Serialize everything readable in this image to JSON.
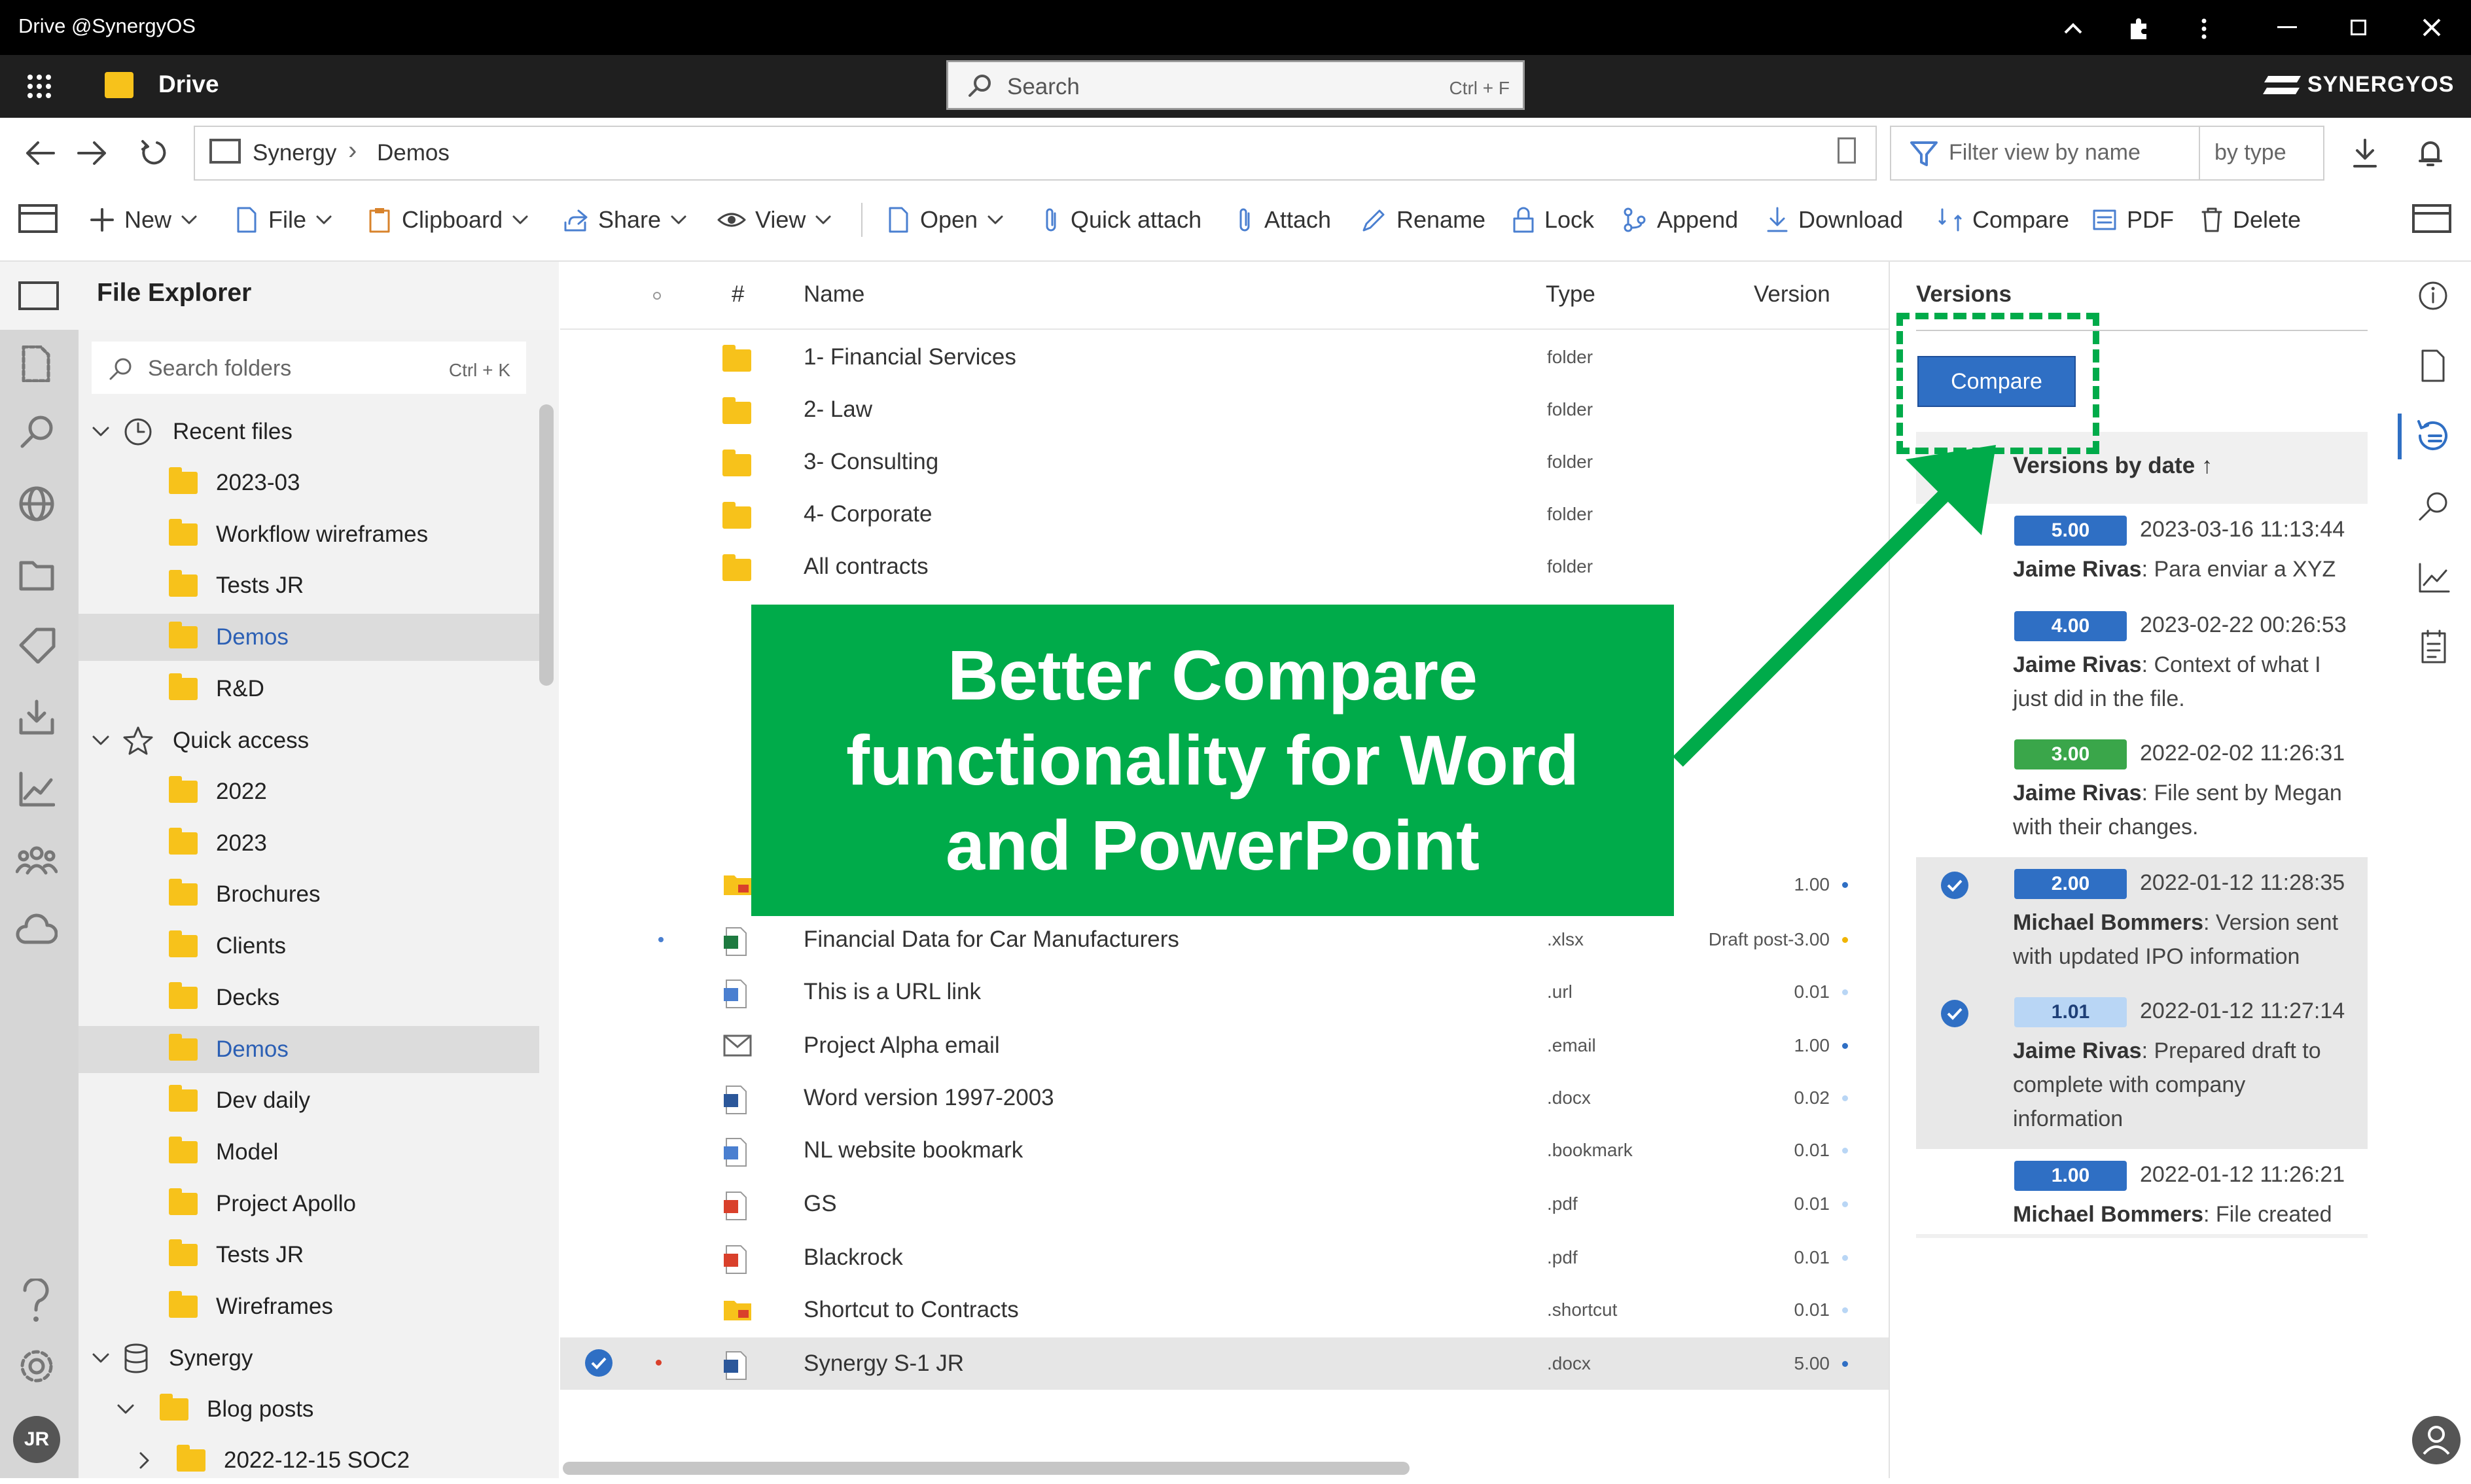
{
  "window": {
    "title": "Drive @SynergyOS"
  },
  "header": {
    "app_name": "Drive",
    "brand": "SYNERGYOS",
    "search_placeholder": "Search",
    "search_shortcut": "Ctrl + F"
  },
  "address": {
    "crumbs": [
      "Synergy",
      "Demos"
    ],
    "filter_placeholder": "Filter view by name",
    "by_type": "by type"
  },
  "toolbar": {
    "new": "New",
    "file": "File",
    "clipboard": "Clipboard",
    "share": "Share",
    "view": "View",
    "open": "Open",
    "quick_attach": "Quick attach",
    "attach": "Attach",
    "rename": "Rename",
    "lock": "Lock",
    "append": "Append",
    "download": "Download",
    "compare": "Compare",
    "pdf": "PDF",
    "delete": "Delete"
  },
  "explorer": {
    "title": "File Explorer",
    "search_placeholder": "Search folders",
    "search_shortcut": "Ctrl + K",
    "recent_label": "Recent files",
    "recent": [
      "2023-03",
      "Workflow wireframes",
      "Tests JR",
      "Demos",
      "R&D"
    ],
    "quick_label": "Quick access",
    "quick": [
      "2022",
      "2023",
      "Brochures",
      "Clients",
      "Decks",
      "Demos",
      "Dev daily",
      "Model",
      "Project Apollo",
      "Tests JR",
      "Wireframes"
    ],
    "synergy_label": "Synergy",
    "synergy_child": "Blog posts",
    "synergy_grandchild": "2022-12-15 SOC2",
    "avatar": "JR"
  },
  "list": {
    "headers": {
      "hash": "#",
      "name": "Name",
      "type": "Type",
      "version": "Version"
    },
    "rows": [
      {
        "name": "1- Financial Services",
        "type": "folder",
        "version": ""
      },
      {
        "name": "2- Law",
        "type": "folder",
        "version": ""
      },
      {
        "name": "3- Consulting",
        "type": "folder",
        "version": ""
      },
      {
        "name": "4- Corporate",
        "type": "folder",
        "version": ""
      },
      {
        "name": "All contracts",
        "type": "folder",
        "version": ""
      },
      {
        "name": "",
        "type": "",
        "version": "1.00"
      },
      {
        "name": "Financial Data for Car Manufacturers",
        "type": ".xlsx",
        "version": "Draft post-3.00"
      },
      {
        "name": "This is a URL link",
        "type": ".url",
        "version": "0.01"
      },
      {
        "name": "Project Alpha email",
        "type": ".email",
        "version": "1.00"
      },
      {
        "name": "Word version 1997-2003",
        "type": ".docx",
        "version": "0.02"
      },
      {
        "name": "NL website bookmark",
        "type": ".bookmark",
        "version": "0.01"
      },
      {
        "name": "GS",
        "type": ".pdf",
        "version": "0.01"
      },
      {
        "name": "Blackrock",
        "type": ".pdf",
        "version": "0.01"
      },
      {
        "name": "Shortcut to Contracts",
        "type": ".shortcut",
        "version": "0.01"
      },
      {
        "name": "Synergy S-1 JR",
        "type": ".docx",
        "version": "5.00"
      }
    ]
  },
  "versions": {
    "title": "Versions",
    "compare_label": "Compare",
    "sort_label": "Versions by date ↑",
    "items": [
      {
        "badge": "5.00",
        "date": "2023-03-16 11:13:44",
        "author": "Jaime Rivas",
        "note": "Para enviar a XYZ"
      },
      {
        "badge": "4.00",
        "date": "2023-02-22 00:26:53",
        "author": "Jaime Rivas",
        "note": "Context of what I just did in the file."
      },
      {
        "badge": "3.00",
        "date": "2022-02-02 11:26:31",
        "author": "Jaime Rivas",
        "note": "File sent by Megan with their changes."
      },
      {
        "badge": "2.00",
        "date": "2022-01-12 11:28:35",
        "author": "Michael Bommers",
        "note": "Version sent with updated IPO information"
      },
      {
        "badge": "1.01",
        "date": "2022-01-12 11:27:14",
        "author": "Jaime Rivas",
        "note": "Prepared draft to complete with company information"
      },
      {
        "badge": "1.00",
        "date": "2022-01-12 11:26:21",
        "author": "Michael Bommers",
        "note": "File created"
      }
    ]
  },
  "overlay": {
    "line1": "Better Compare",
    "line2": "functionality for Word",
    "line3": "and PowerPoint"
  },
  "colors": {
    "accent": "#2f6fc4",
    "callout": "#00ab4a",
    "badge_green": "#3aa64a",
    "badge_light": "#b9d6f5"
  }
}
